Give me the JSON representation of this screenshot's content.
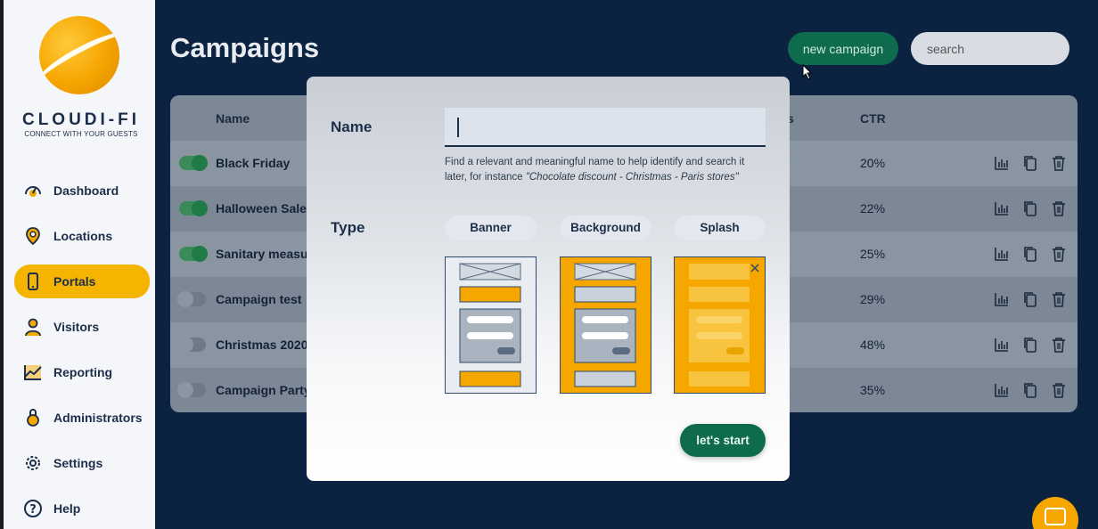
{
  "sidebar": {
    "brand": "CLOUDI-FI",
    "tagline": "CONNECT WITH YOUR GUESTS",
    "items": [
      {
        "label": "Dashboard",
        "icon": "dashboard-icon"
      },
      {
        "label": "Locations",
        "icon": "location-pin-icon"
      },
      {
        "label": "Portals",
        "icon": "phone-icon",
        "active": true
      },
      {
        "label": "Visitors",
        "icon": "user-icon"
      },
      {
        "label": "Reporting",
        "icon": "chart-icon"
      },
      {
        "label": "Administrators",
        "icon": "lock-icon"
      },
      {
        "label": "Settings",
        "icon": "gear-icon"
      },
      {
        "label": "Help",
        "icon": "help-icon"
      }
    ]
  },
  "header": {
    "title": "Campaigns",
    "new_campaign_label": "new campaign",
    "search_placeholder": "search"
  },
  "table": {
    "columns": {
      "name": "Name",
      "partial": "s",
      "ctr": "CTR"
    },
    "rows": [
      {
        "name": "Black Friday",
        "enabled": true,
        "ctr": "20%"
      },
      {
        "name": "Halloween Sales",
        "enabled": true,
        "ctr": "22%"
      },
      {
        "name": "Sanitary measur",
        "enabled": true,
        "ctr": "25%"
      },
      {
        "name": "Campaign test",
        "enabled": false,
        "ctr": "29%"
      },
      {
        "name": "Christmas 2020",
        "enabled": false,
        "ctr": "48%"
      },
      {
        "name": "Campaign Party",
        "enabled": false,
        "ctr": "35%"
      }
    ]
  },
  "modal": {
    "name_label": "Name",
    "name_value": "",
    "hint_text": "Find a relevant and meaningful name to help identify and search it later, for instance ",
    "hint_example": "\"Chocolate discount - Christmas - Paris stores\"",
    "type_label": "Type",
    "types": [
      "Banner",
      "Background",
      "Splash"
    ],
    "start_label": "let's start"
  },
  "colors": {
    "accent": "#f5b400",
    "primary_green": "#0f6b4e",
    "navy": "#0b2340"
  }
}
